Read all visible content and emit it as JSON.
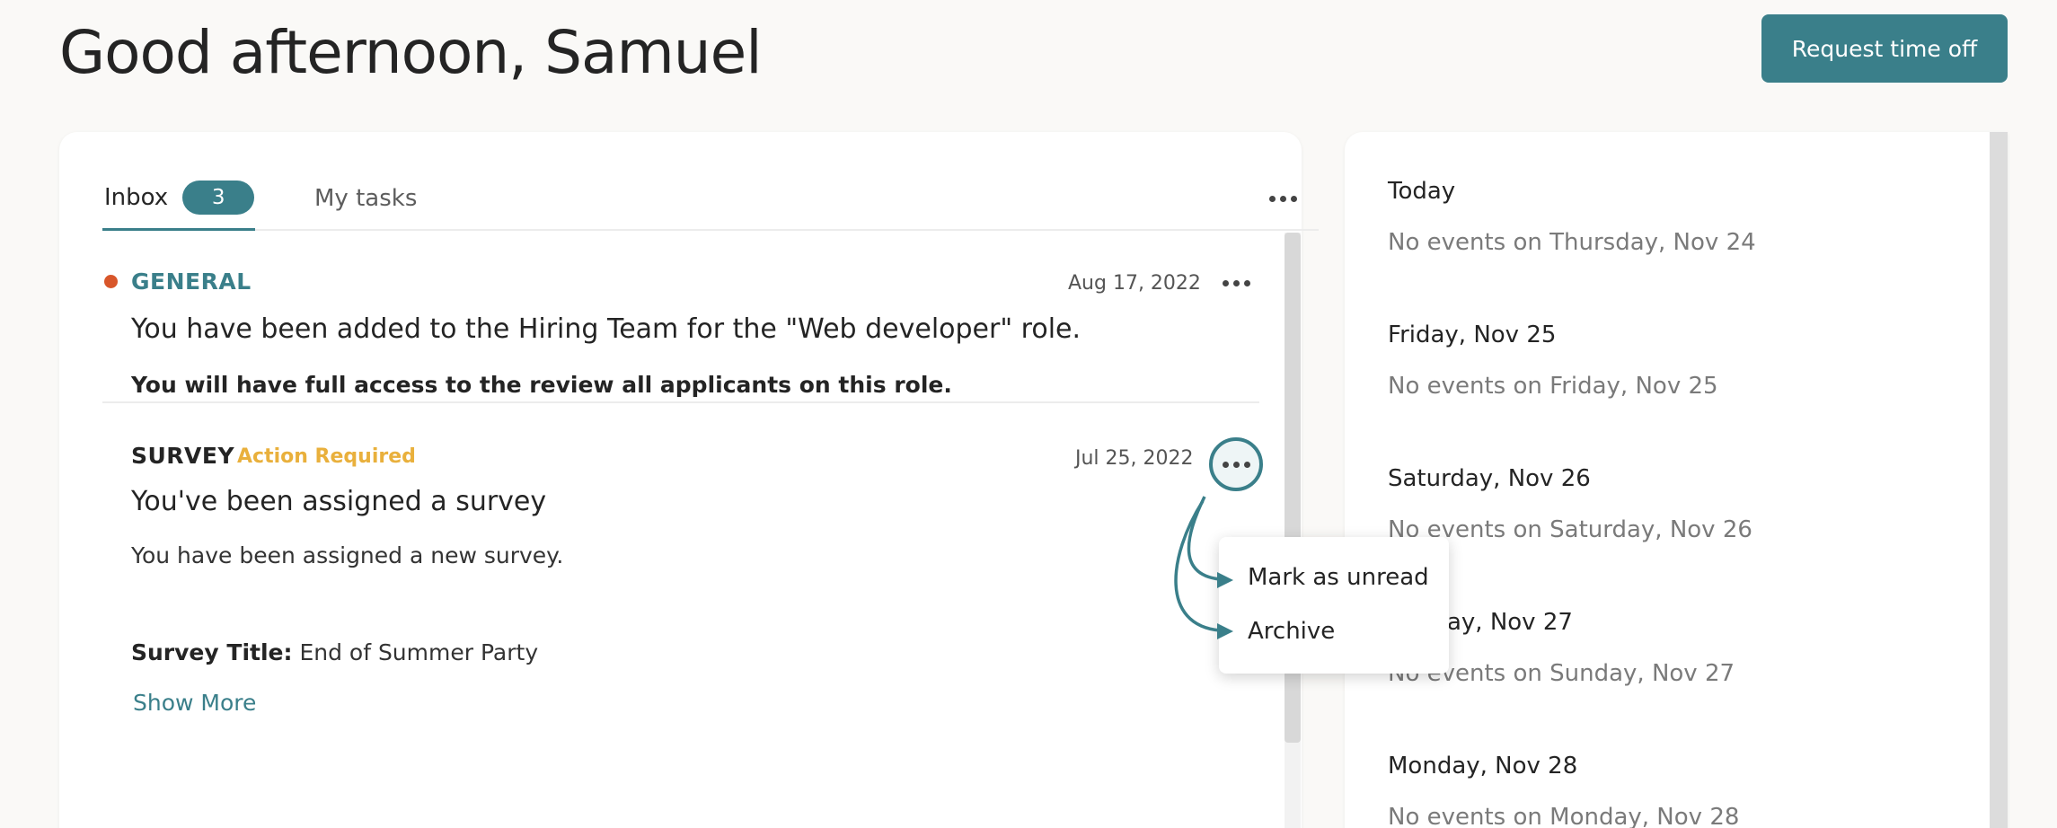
{
  "header": {
    "greeting": "Good afternoon, Samuel",
    "request_button": "Request time off"
  },
  "tabs": {
    "inbox_label": "Inbox",
    "inbox_count": "3",
    "tasks_label": "My tasks"
  },
  "messages": [
    {
      "category": "GENERAL",
      "date": "Aug 17, 2022",
      "title": "You have been added to the Hiring Team for the \"Web developer\" role.",
      "body": "You will have full access to the review all applicants on this role.",
      "unread": true
    },
    {
      "category": "SURVEY",
      "badge": "Action Required",
      "date": "Jul 25, 2022",
      "title": "You've been assigned a survey",
      "body": "You have been assigned a new survey.",
      "survey_title_label": "Survey Title:",
      "survey_title_value": "End of Summer Party",
      "show_more": "Show More"
    }
  ],
  "context_menu": {
    "items": [
      "Mark as unread",
      "Archive"
    ]
  },
  "calendar": {
    "days": [
      {
        "label": "Today",
        "empty": "No events on Thursday, Nov 24"
      },
      {
        "label": "Friday, Nov 25",
        "empty": "No events on Friday, Nov 25"
      },
      {
        "label": "Saturday, Nov 26",
        "empty": "No events on Saturday, Nov 26"
      },
      {
        "label": "Sunday, Nov 27",
        "empty": "No events on Sunday, Nov 27"
      },
      {
        "label": "Monday, Nov 28",
        "empty": "No events on Monday, Nov 28"
      }
    ]
  },
  "colors": {
    "accent": "#3a7f8a",
    "unread_dot": "#d8562a",
    "action_required": "#e9b03c"
  },
  "icons": [
    "more-horizontal-icon"
  ]
}
